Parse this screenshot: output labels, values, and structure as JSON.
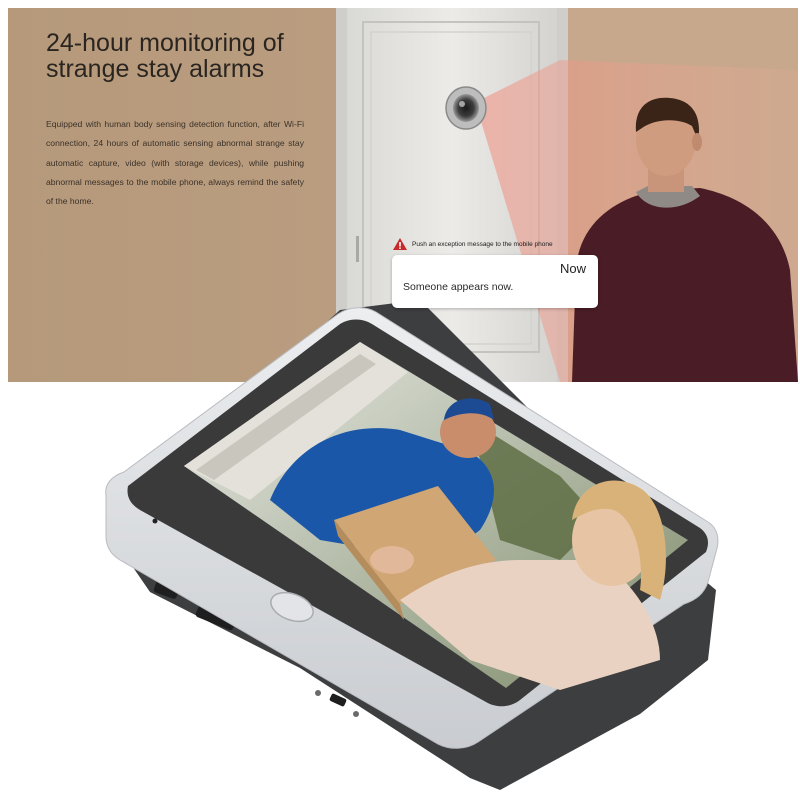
{
  "banner": {
    "headline_line1": "24-hour monitoring of",
    "headline_line2": "strange stay alarms",
    "description": "Equipped with human body sensing detection function, after Wi-Fi connection, 24 hours of automatic sensing abnormal strange stay automatic capture, video (with storage devices), while pushing abnormal messages to the mobile phone, always remind the safety of the home."
  },
  "alert": {
    "label": "Push an exception message to the mobile phone",
    "icon": "warning-triangle-icon"
  },
  "notification": {
    "time": "Now",
    "message": "Someone appears now."
  },
  "colors": {
    "banner_background": "#b89c7d",
    "device_frame": "#d8dbdf",
    "device_bezel": "#3b3b3b",
    "alert_red": "#c62a2a"
  }
}
